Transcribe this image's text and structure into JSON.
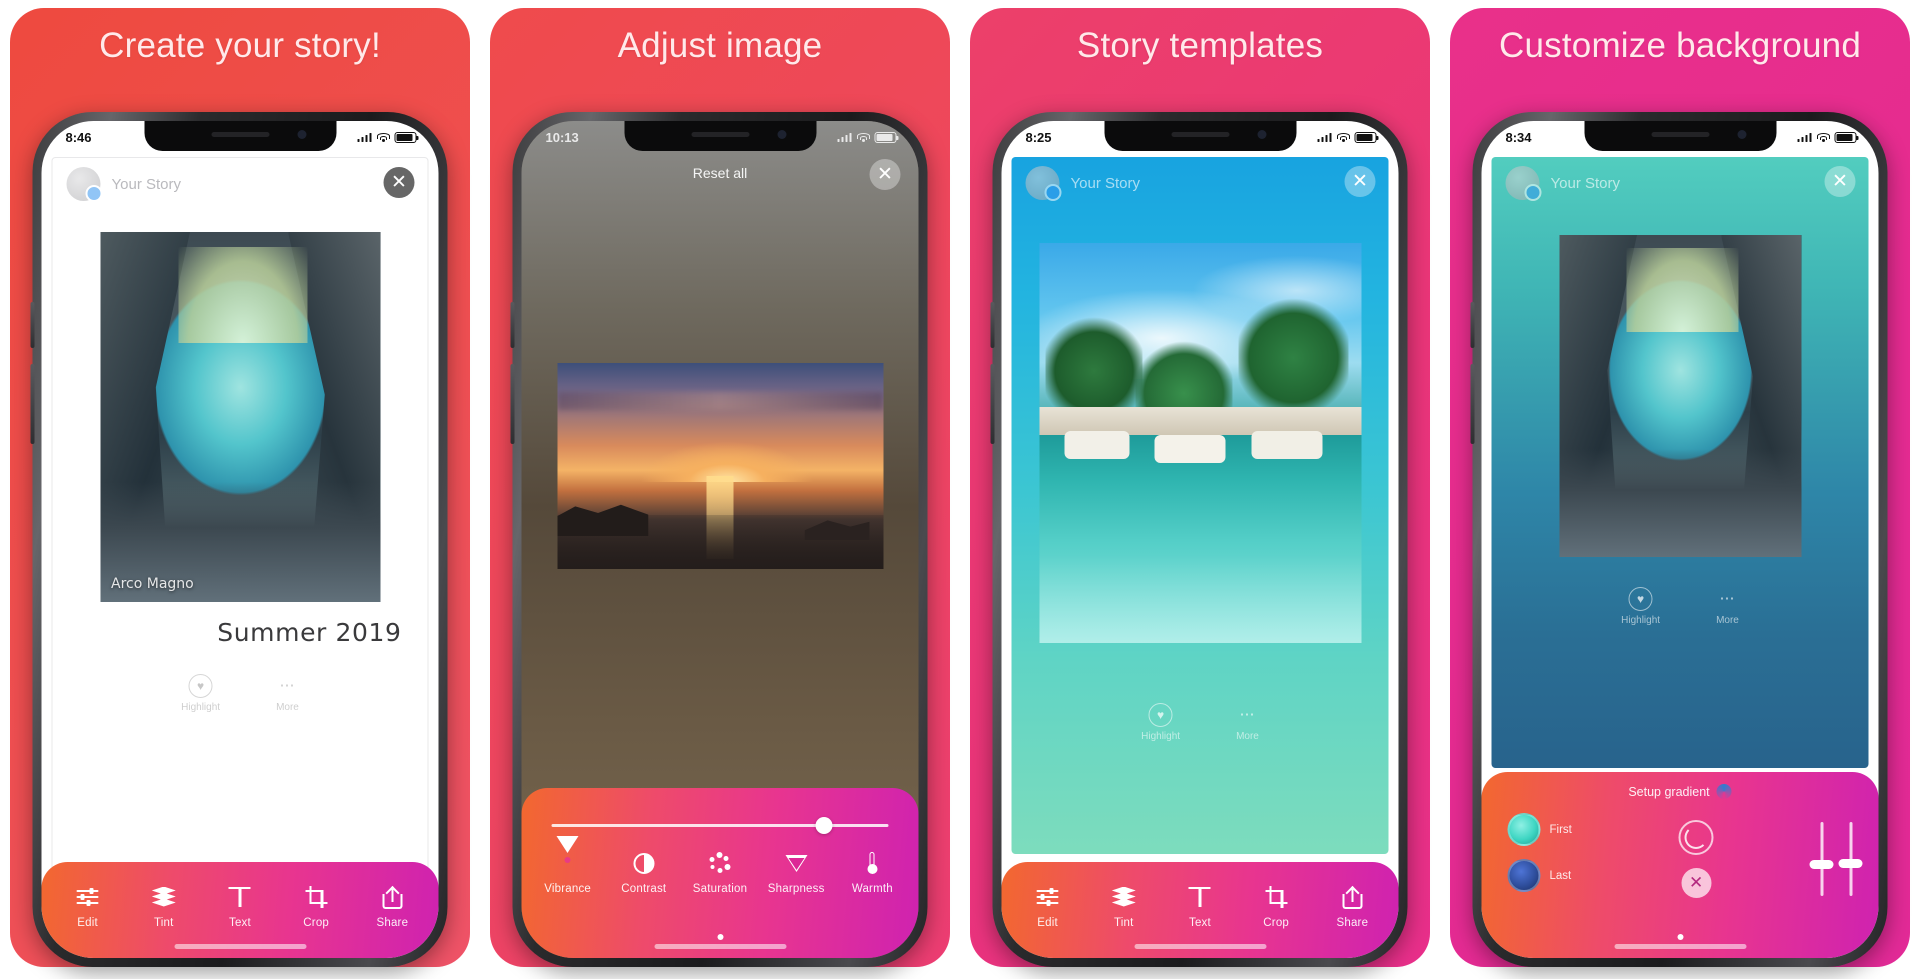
{
  "meta": {
    "accent_orange": "#f2682f",
    "accent_pink": "#e8358f",
    "accent_magenta": "#cf22b0"
  },
  "panels": [
    {
      "id": "create",
      "title": "Create your story!",
      "bg_from": "#ef4a42",
      "bg_to": "#ef5260",
      "status": {
        "time": "8:46",
        "light": false
      },
      "story": {
        "user": "Your Story",
        "close_label": "✕",
        "photo_caption": "Arco Magno",
        "summer_text": "Summer 2019"
      },
      "highlights": [
        {
          "label": "Highlight",
          "icon": "heart-icon"
        },
        {
          "label": "More",
          "icon": "ellipsis-icon"
        }
      ],
      "toolbar": [
        {
          "label": "Edit",
          "icon": "sliders-icon"
        },
        {
          "label": "Tint",
          "icon": "layers-icon"
        },
        {
          "label": "Text",
          "icon": "text-icon"
        },
        {
          "label": "Crop",
          "icon": "crop-icon"
        },
        {
          "label": "Share",
          "icon": "share-icon"
        }
      ]
    },
    {
      "id": "adjust",
      "title": "Adjust image",
      "bg_from": "#ef4a52",
      "bg_to": "#ec3f6f",
      "status": {
        "time": "10:13",
        "light": true
      },
      "reset_label": "Reset all",
      "slider": {
        "value_pct": 76
      },
      "toolbar": [
        {
          "label": "Vibrance",
          "icon": "vibrance-icon"
        },
        {
          "label": "Contrast",
          "icon": "contrast-icon"
        },
        {
          "label": "Saturation",
          "icon": "saturation-icon"
        },
        {
          "label": "Sharpness",
          "icon": "sharpness-icon"
        },
        {
          "label": "Warmth",
          "icon": "thermometer-icon"
        }
      ]
    },
    {
      "id": "templates",
      "title": "Story templates",
      "bg_from": "#ec3f6f",
      "bg_to": "#e82f85",
      "status": {
        "time": "8:25",
        "light": false
      },
      "story": {
        "user": "Your Story",
        "close_label": "✕"
      },
      "highlights": [
        {
          "label": "Highlight",
          "icon": "heart-icon"
        },
        {
          "label": "More",
          "icon": "ellipsis-icon"
        }
      ],
      "toolbar": [
        {
          "label": "Edit",
          "icon": "sliders-icon"
        },
        {
          "label": "Tint",
          "icon": "layers-icon"
        },
        {
          "label": "Text",
          "icon": "text-icon"
        },
        {
          "label": "Crop",
          "icon": "crop-icon"
        },
        {
          "label": "Share",
          "icon": "share-icon"
        }
      ]
    },
    {
      "id": "background",
      "title": "Customize background",
      "bg_from": "#e8308b",
      "bg_to": "#e32a94",
      "status": {
        "time": "8:34",
        "light": false
      },
      "story": {
        "user": "Your Story",
        "close_label": "✕"
      },
      "highlights": [
        {
          "label": "Highlight",
          "icon": "heart-icon"
        },
        {
          "label": "More",
          "icon": "ellipsis-icon"
        }
      ],
      "gradient_panel": {
        "title": "Setup gradient",
        "badge_icon": "gradient-badge-icon",
        "swatches": [
          {
            "label": "First",
            "color": "#3fd6c3"
          },
          {
            "label": "Last",
            "color": "#2f4f9e"
          }
        ],
        "rotate_icon": "rotate-icon",
        "clear_icon": "close-circle-icon",
        "sliders": [
          {
            "value_pct": 50
          },
          {
            "value_pct": 52
          }
        ]
      }
    }
  ]
}
